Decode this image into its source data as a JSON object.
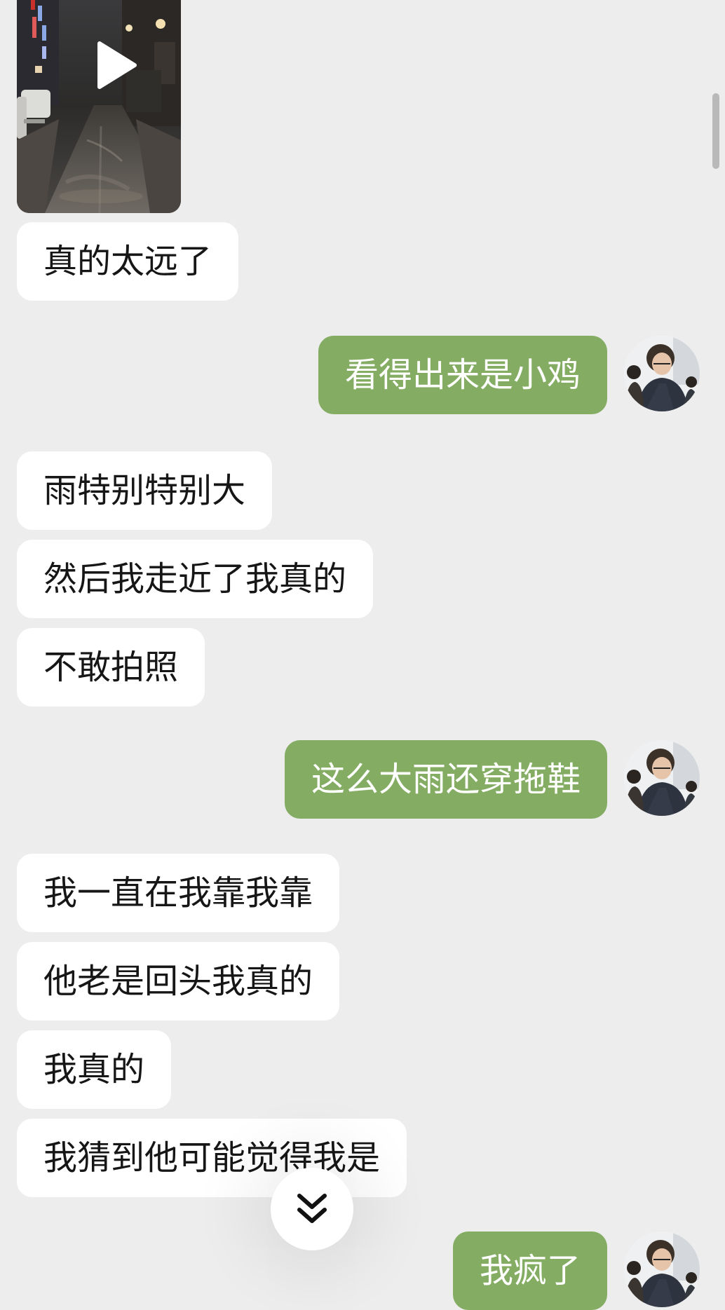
{
  "chat": {
    "video": {
      "type": "video-message",
      "icon": "play-icon"
    },
    "messages": [
      {
        "side": "in",
        "text": "真的太远了"
      },
      {
        "side": "out",
        "text": "看得出来是小鸡"
      },
      {
        "side": "in",
        "text": "雨特别特别大"
      },
      {
        "side": "in",
        "text": "然后我走近了我真的"
      },
      {
        "side": "in",
        "text": "不敢拍照"
      },
      {
        "side": "out",
        "text": "这么大雨还穿拖鞋"
      },
      {
        "side": "in",
        "text": "我一直在我靠我靠"
      },
      {
        "side": "in",
        "text": "他老是回头我真的"
      },
      {
        "side": "in",
        "text": "我真的"
      },
      {
        "side": "in",
        "text": "我猜到他可能觉得我是"
      },
      {
        "side": "out",
        "text": "我疯了"
      }
    ],
    "jump_to_bottom": {
      "icon": "double-chevron-down-icon"
    }
  },
  "colors": {
    "background": "#ededed",
    "incoming_bubble": "#ffffff",
    "outgoing_bubble": "#84ad63",
    "outgoing_text": "#ffffff"
  }
}
